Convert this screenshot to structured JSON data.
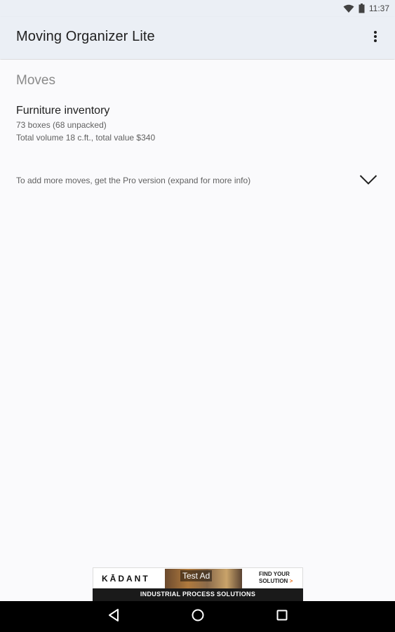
{
  "status_bar": {
    "time": "11:37",
    "icons": [
      "wifi-icon",
      "battery-icon"
    ]
  },
  "app_bar": {
    "title": "Moving Organizer Lite",
    "overflow_icon": "more-vertical-icon"
  },
  "moves": {
    "header": "Moves",
    "items": [
      {
        "title": "Furniture inventory",
        "line1": "73 boxes (68 unpacked)",
        "line2": "Total volume 18 c.ft., total value $340"
      }
    ],
    "pro_prompt": "To add more moves, get the Pro version (expand for more info)",
    "pro_icon": "chevron-down-icon"
  },
  "ad": {
    "brand": "KĀDANT",
    "label": "Test Ad",
    "cta_line1": "FIND YOUR",
    "cta_line2": "SOLUTION",
    "cta_arrow": ">",
    "tagline": "INDUSTRIAL PROCESS SOLUTIONS"
  },
  "nav_bar": {
    "icons": [
      "back-icon",
      "home-icon",
      "recents-icon"
    ]
  },
  "colors": {
    "app_bar_bg": "#ebeff5",
    "background": "#fafafc",
    "section_header": "#8a8a8a",
    "nav_bar_bg": "#000000"
  }
}
